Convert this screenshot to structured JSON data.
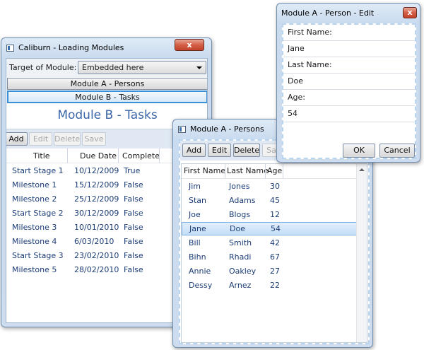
{
  "loading_window": {
    "title": "Caliburn - Loading Modules",
    "close_glyph": "x",
    "target_label": "Target of Module:",
    "target_value": "Embedded here",
    "module_buttons": [
      "Module A - Persons",
      "Module B - Tasks"
    ],
    "module_heading": "Module B - Tasks",
    "toolbar": [
      "Add",
      "Edit",
      "Delete",
      "Save"
    ],
    "columns": [
      "Title",
      "Due Date",
      "Complete"
    ],
    "tasks": [
      [
        "Start Stage 1",
        "10/12/2009",
        "True"
      ],
      [
        "Milestone 1",
        "15/12/2009",
        "False"
      ],
      [
        "Milestone 2",
        "25/12/2009",
        "False"
      ],
      [
        "Start Stage 2",
        "30/12/2009",
        "False"
      ],
      [
        "Milestone 3",
        "10/01/2010",
        "False"
      ],
      [
        "Milestone 4",
        "6/03/2010",
        "False"
      ],
      [
        "Start Stage 3",
        "23/02/2010",
        "False"
      ],
      [
        "Milestone 5",
        "28/02/2010",
        "False"
      ]
    ]
  },
  "persons_window": {
    "title": "Module A - Persons",
    "toolbar": [
      "Add",
      "Edit",
      "Delete",
      "Sa"
    ],
    "columns": [
      "First Name",
      "Last Name",
      "Age"
    ],
    "selected_index": 3,
    "persons": [
      [
        "Jim",
        "Jones",
        "30"
      ],
      [
        "Stan",
        "Adams",
        "45"
      ],
      [
        "Joe",
        "Blogs",
        "12"
      ],
      [
        "Jane",
        "Doe",
        "54"
      ],
      [
        "Bill",
        "Smith",
        "42"
      ],
      [
        "Bihn",
        "Rhadi",
        "67"
      ],
      [
        "Annie",
        "Oakley",
        "27"
      ],
      [
        "Dessy",
        "Arnez",
        "22"
      ]
    ]
  },
  "edit_window": {
    "title": "Module A - Person - Edit",
    "close_glyph": "x",
    "rows": [
      "First Name:",
      "Jane",
      "Last Name:",
      "Doe",
      "Age:",
      "54"
    ],
    "ok_label": "OK",
    "cancel_label": "Cancel"
  },
  "icons": {
    "dropdown": "chevron-down-icon",
    "scroll_up": "scroll-up-arrow-icon"
  },
  "colors": {
    "selection": "#cfe3f8",
    "heading": "#3a66a8",
    "link_text": "#1b3c76"
  }
}
